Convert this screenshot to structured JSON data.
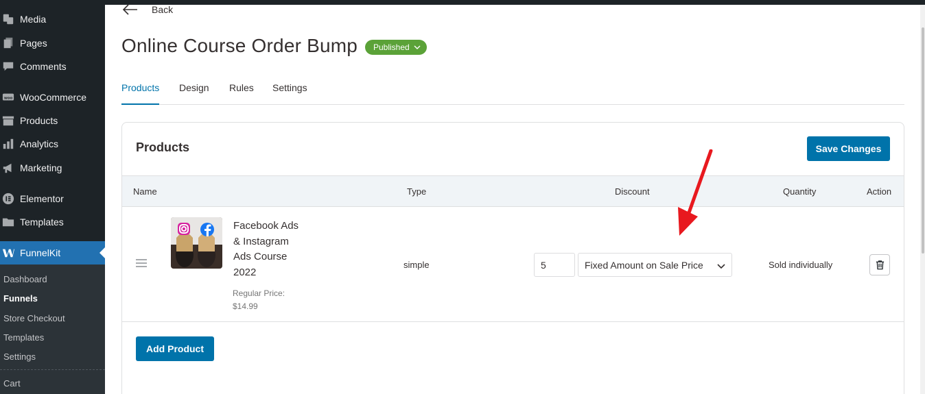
{
  "sidebar": {
    "items": [
      {
        "label": "Media",
        "icon": "media-icon"
      },
      {
        "label": "Pages",
        "icon": "pages-icon"
      },
      {
        "label": "Comments",
        "icon": "comments-icon"
      },
      {
        "label": "WooCommerce",
        "icon": "woocommerce-icon"
      },
      {
        "label": "Products",
        "icon": "products-icon"
      },
      {
        "label": "Analytics",
        "icon": "analytics-icon"
      },
      {
        "label": "Marketing",
        "icon": "marketing-icon"
      },
      {
        "label": "Elementor",
        "icon": "elementor-icon"
      },
      {
        "label": "Templates",
        "icon": "templates-icon"
      },
      {
        "label": "FunnelKit",
        "icon": "funnelkit-icon"
      }
    ],
    "submenu": [
      "Dashboard",
      "Funnels",
      "Store Checkout",
      "Templates",
      "Settings"
    ],
    "submenu_current": "Funnels",
    "after_separator": "Cart",
    "active_color": "#2271b1"
  },
  "header": {
    "back_label": "Back",
    "title": "Online Course Order Bump",
    "status": "Published",
    "status_color": "#5ba238"
  },
  "tabs": [
    "Products",
    "Design",
    "Rules",
    "Settings"
  ],
  "active_tab": "Products",
  "panel": {
    "title": "Products",
    "save_label": "Save Changes",
    "add_label": "Add Product",
    "columns": [
      "Name",
      "Type",
      "Discount",
      "Quantity",
      "Action"
    ],
    "rows": [
      {
        "name_lines": [
          "Facebook Ads",
          "& Instagram",
          "Ads Course",
          "2022"
        ],
        "price_label": "Regular Price:",
        "price": "$14.99",
        "type": "simple",
        "discount_value": "5",
        "discount_type": "Fixed Amount on Sale Price",
        "quantity": "Sold individually",
        "action_icon": "trash-icon"
      }
    ]
  },
  "accent_color": "#0073aa",
  "annotation_arrow_color": "#e8191f"
}
